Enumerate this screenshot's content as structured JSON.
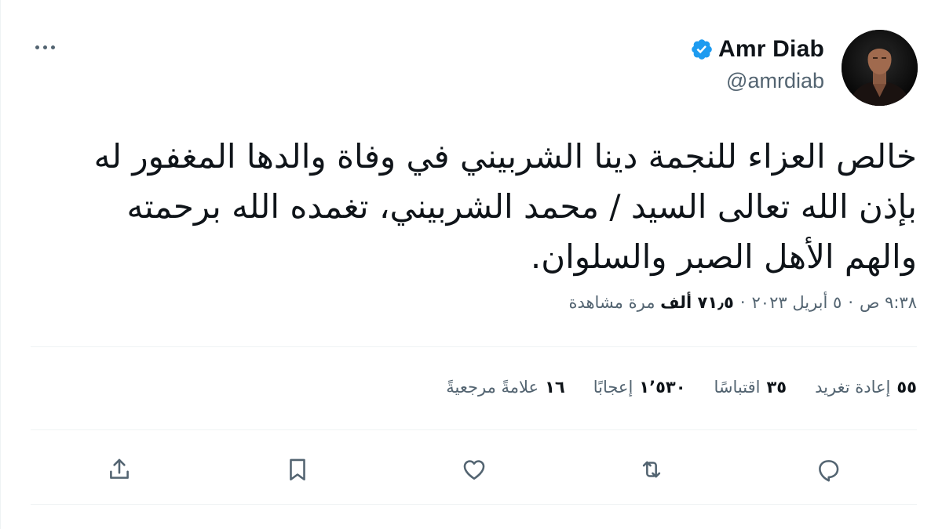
{
  "user": {
    "name": "Amr Diab",
    "handle": "@amrdiab",
    "verified": true
  },
  "tweet": {
    "text": "خالص العزاء للنجمة دينا الشربيني في وفاة والدها المغفور له بإذن الله تعالى السيد / محمد الشربيني، تغمده الله برحمته والهم الأهل الصبر والسلوان."
  },
  "meta": {
    "time": "٩:٣٨ ص",
    "date": "٥ أبريل ٢٠٢٣",
    "views_count": "٧١٫٥ ألف",
    "views_label": "مرة مشاهدة",
    "separator": "·"
  },
  "stats": [
    {
      "count": "٥٥",
      "label": "إعادة تغريد"
    },
    {
      "count": "٣٥",
      "label": "اقتباسًا"
    },
    {
      "count": "١٬٥٣٠",
      "label": "إعجابًا"
    },
    {
      "count": "١٦",
      "label": "علامةً مرجعيةً"
    }
  ],
  "actions": {
    "reply_icon": "reply-icon",
    "retweet_icon": "retweet-icon",
    "like_icon": "heart-icon",
    "bookmark_icon": "bookmark-icon",
    "share_icon": "share-icon"
  },
  "colors": {
    "text": "#0f1419",
    "secondary": "#536471",
    "verified": "#1d9bf0",
    "divider": "#eff3f4"
  }
}
